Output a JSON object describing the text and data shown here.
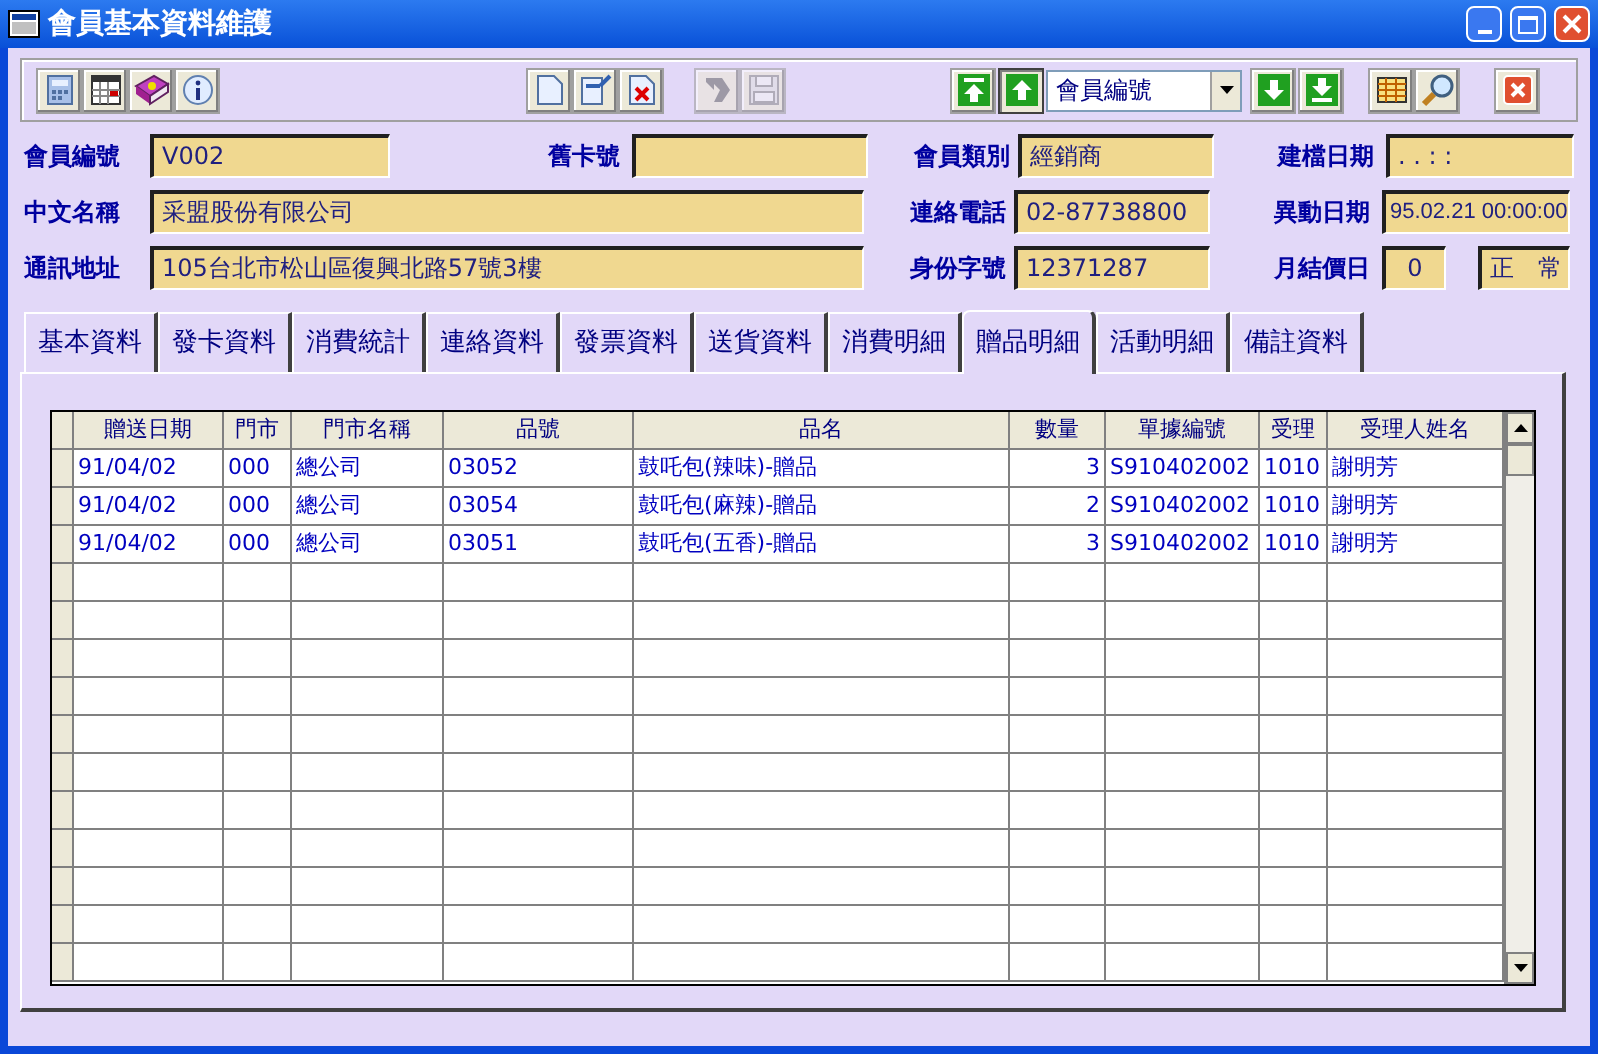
{
  "window": {
    "title": "會員基本資料維護"
  },
  "toolbar": {
    "left": [
      {
        "kind": "calculator",
        "disabled": false
      },
      {
        "kind": "calendar",
        "disabled": false
      },
      {
        "kind": "book",
        "disabled": false
      },
      {
        "kind": "info",
        "disabled": false
      }
    ],
    "middle": [
      {
        "kind": "new",
        "disabled": false
      },
      {
        "kind": "edit",
        "disabled": false
      },
      {
        "kind": "delete",
        "disabled": false
      },
      {
        "kind": "undo",
        "disabled": true
      },
      {
        "kind": "save",
        "disabled": true
      }
    ],
    "nav_up": [
      {
        "kind": "first",
        "selected": false
      },
      {
        "kind": "prev",
        "selected": true
      }
    ],
    "sort_field": {
      "value": "會員編號"
    },
    "nav_down": [
      {
        "kind": "next",
        "selected": false
      },
      {
        "kind": "last",
        "selected": false
      }
    ],
    "right": [
      {
        "kind": "grid",
        "disabled": false
      },
      {
        "kind": "search",
        "disabled": false
      },
      {
        "kind": "close",
        "disabled": false
      }
    ]
  },
  "form": [
    [
      {
        "label": "會員編號",
        "value": "V002"
      },
      {
        "label": "舊卡號"
      },
      {
        "label": "會員類別",
        "value": "經銷商"
      },
      {
        "label": "建檔日期",
        "value": ". .  : :"
      }
    ],
    [
      {
        "label": "中文名稱",
        "value": "采盟股份有限公司"
      },
      {
        "label": "連絡電話",
        "value": "02-87738800"
      },
      {
        "label": "異動日期",
        "value": "95.02.21 00:00:00"
      }
    ],
    [
      {
        "label": "通訊地址",
        "value": "105台北市松山區復興北路57號3樓"
      },
      {
        "label": "身份字號",
        "value": "12371287"
      },
      {
        "label": "月結價日",
        "value": "0"
      },
      {
        "value": "正　常"
      }
    ]
  ],
  "tabs": [
    {
      "label": "基本資料",
      "selected": false
    },
    {
      "label": "發卡資料",
      "selected": false
    },
    {
      "label": "消費統計",
      "selected": false
    },
    {
      "label": "連絡資料",
      "selected": false
    },
    {
      "label": "發票資料",
      "selected": false
    },
    {
      "label": "送貨資料",
      "selected": false
    },
    {
      "label": "消費明細",
      "selected": false
    },
    {
      "label": "贈品明細",
      "selected": true
    },
    {
      "label": "活動明細",
      "selected": false
    },
    {
      "label": "備註資料",
      "selected": false
    }
  ],
  "table": {
    "columns": [
      "贈送日期",
      "門市",
      "門市名稱",
      "品號",
      "品名",
      "數量",
      "單據編號",
      "受理",
      "受理人姓名"
    ],
    "rows": [
      [
        "91/04/02",
        "000",
        "總公司",
        "03052",
        "鼓吒包(辣味)-贈品",
        "3",
        "S910402002",
        "1010",
        "謝明芳"
      ],
      [
        "91/04/02",
        "000",
        "總公司",
        "03054",
        "鼓吒包(麻辣)-贈品",
        "2",
        "S910402002",
        "1010",
        "謝明芳"
      ],
      [
        "91/04/02",
        "000",
        "總公司",
        "03051",
        "鼓吒包(五香)-贈品",
        "3",
        "S910402002",
        "1010",
        "謝明芳"
      ]
    ]
  }
}
